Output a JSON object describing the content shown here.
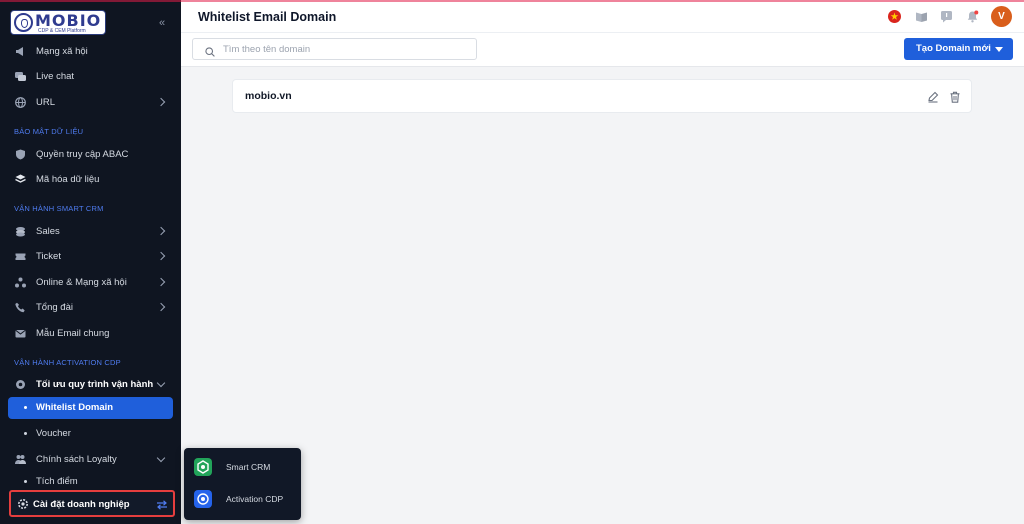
{
  "logo": {
    "text": "MOBIO",
    "subtitle": "CDP & CEM Platform"
  },
  "sidebar": {
    "items_top": [
      {
        "label": "Mạng xã hội"
      },
      {
        "label": "Live chat"
      },
      {
        "label": "URL"
      }
    ],
    "section_security": "BẢO MẬT DỮ LIỆU",
    "security_items": [
      {
        "label": "Quyền truy cập ABAC"
      },
      {
        "label": "Mã hóa dữ liệu"
      }
    ],
    "section_crm": "VẬN HÀNH SMART CRM",
    "crm_items": [
      {
        "label": "Sales"
      },
      {
        "label": "Ticket"
      },
      {
        "label": "Online & Mạng xã hội"
      },
      {
        "label": "Tổng đài"
      },
      {
        "label": "Mẫu Email chung"
      }
    ],
    "section_cdp": "VẬN HÀNH ACTIVATION CDP",
    "cdp_group": "Tối ưu quy trình vận hành",
    "cdp_sub": [
      {
        "label": "Whitelist Domain",
        "active": true
      },
      {
        "label": "Voucher"
      }
    ],
    "loyalty": "Chính sách Loyalty",
    "loyalty_sub": "Tích điểm",
    "enterprise_settings": "Cài đặt doanh nghiệp"
  },
  "switcher": {
    "items": [
      {
        "label": "Smart CRM",
        "color": "#22a45a"
      },
      {
        "label": "Activation CDP",
        "color": "#2563eb"
      }
    ]
  },
  "header": {
    "title": "Whitelist Email Domain",
    "avatar_initial": "V"
  },
  "toolbar": {
    "search_placeholder": "Tìm theo tên domain",
    "create_label": "Tạo Domain mới"
  },
  "domains": [
    {
      "name": "mobio.vn"
    }
  ],
  "colors": {
    "sidebar_bg": "#0f1521",
    "accent": "#1f5fdb",
    "section": "#4f7cf0",
    "highlight_border": "#e53e3e",
    "avatar": "#d95e1b"
  }
}
